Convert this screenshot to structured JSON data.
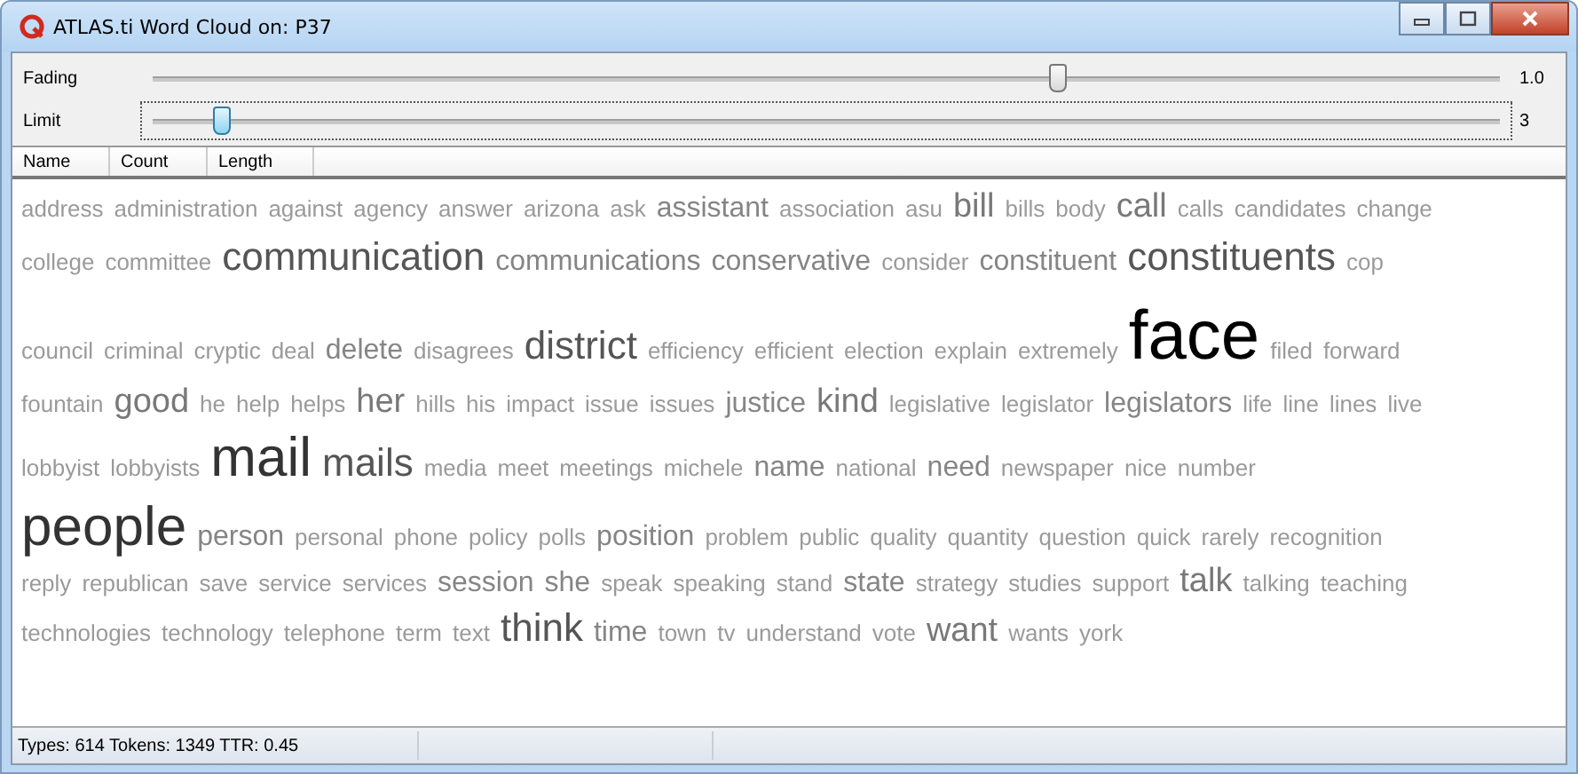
{
  "window": {
    "title": "ATLAS.ti Word Cloud on: P37"
  },
  "sliders": [
    {
      "label": "Fading",
      "level": 0.67,
      "reading": "1.0",
      "focused": false
    },
    {
      "label": "Limit",
      "level": 0.05,
      "reading": "3",
      "focused": true
    }
  ],
  "columns": [
    "Name",
    "Count",
    "Length"
  ],
  "cloud_lines": [
    [
      {
        "word": "address",
        "kind": "s"
      },
      {
        "word": "administration",
        "kind": "s"
      },
      {
        "word": "against",
        "kind": "s"
      },
      {
        "word": "agency",
        "kind": "s"
      },
      {
        "word": "answer",
        "kind": "s"
      },
      {
        "word": "arizona",
        "kind": "s"
      },
      {
        "word": "ask",
        "kind": "s"
      },
      {
        "word": "assistant",
        "kind": "m"
      },
      {
        "word": "association",
        "kind": "s"
      },
      {
        "word": "asu",
        "kind": "s"
      },
      {
        "word": "bill",
        "kind": "l"
      },
      {
        "word": "bills",
        "kind": "s"
      },
      {
        "word": "body",
        "kind": "s"
      },
      {
        "word": "call",
        "kind": "l"
      },
      {
        "word": "calls",
        "kind": "s"
      },
      {
        "word": "candidates",
        "kind": "s"
      },
      {
        "word": "change",
        "kind": "s"
      }
    ],
    [
      {
        "word": "college",
        "kind": "s"
      },
      {
        "word": "committee",
        "kind": "s"
      },
      {
        "word": "communication",
        "kind": "xl"
      },
      {
        "word": "communications",
        "kind": "m"
      },
      {
        "word": "conservative",
        "kind": "m"
      },
      {
        "word": "consider",
        "kind": "s"
      },
      {
        "word": "constituent",
        "kind": "m"
      },
      {
        "word": "constituents",
        "kind": "xl"
      },
      {
        "word": "cop",
        "kind": "s"
      }
    ],
    [
      {
        "word": "council",
        "kind": "s"
      },
      {
        "word": "criminal",
        "kind": "s"
      },
      {
        "word": "cryptic",
        "kind": "s"
      },
      {
        "word": "deal",
        "kind": "s"
      },
      {
        "word": "delete",
        "kind": "m"
      },
      {
        "word": "disagrees",
        "kind": "s"
      },
      {
        "word": "district",
        "kind": "xl"
      },
      {
        "word": "efficiency",
        "kind": "s"
      },
      {
        "word": "efficient",
        "kind": "s"
      },
      {
        "word": "election",
        "kind": "s"
      },
      {
        "word": "explain",
        "kind": "s"
      },
      {
        "word": "extremely",
        "kind": "s"
      },
      {
        "word": "face",
        "kind": "max"
      },
      {
        "word": "filed",
        "kind": "s"
      },
      {
        "word": "forward",
        "kind": "s"
      }
    ],
    [
      {
        "word": "fountain",
        "kind": "s"
      },
      {
        "word": "good",
        "kind": "l"
      },
      {
        "word": "he",
        "kind": "s"
      },
      {
        "word": "help",
        "kind": "s"
      },
      {
        "word": "helps",
        "kind": "s"
      },
      {
        "word": "her",
        "kind": "l"
      },
      {
        "word": "hills",
        "kind": "s"
      },
      {
        "word": "his",
        "kind": "s"
      },
      {
        "word": "impact",
        "kind": "s"
      },
      {
        "word": "issue",
        "kind": "s"
      },
      {
        "word": "issues",
        "kind": "s"
      },
      {
        "word": "justice",
        "kind": "m"
      },
      {
        "word": "kind",
        "kind": "l"
      },
      {
        "word": "legislative",
        "kind": "s"
      },
      {
        "word": "legislator",
        "kind": "s"
      },
      {
        "word": "legislators",
        "kind": "m"
      },
      {
        "word": "life",
        "kind": "s"
      },
      {
        "word": "line",
        "kind": "s"
      },
      {
        "word": "lines",
        "kind": "s"
      },
      {
        "word": "live",
        "kind": "s"
      }
    ],
    [
      {
        "word": "lobbyist",
        "kind": "s"
      },
      {
        "word": "lobbyists",
        "kind": "s"
      },
      {
        "word": "mail",
        "kind": "xxl"
      },
      {
        "word": "mails",
        "kind": "xl"
      },
      {
        "word": "media",
        "kind": "s"
      },
      {
        "word": "meet",
        "kind": "s"
      },
      {
        "word": "meetings",
        "kind": "s"
      },
      {
        "word": "michele",
        "kind": "s"
      },
      {
        "word": "name",
        "kind": "m"
      },
      {
        "word": "national",
        "kind": "s"
      },
      {
        "word": "need",
        "kind": "m"
      },
      {
        "word": "newspaper",
        "kind": "s"
      },
      {
        "word": "nice",
        "kind": "s"
      },
      {
        "word": "number",
        "kind": "s"
      }
    ],
    [
      {
        "word": "people",
        "kind": "xxl"
      },
      {
        "word": "person",
        "kind": "m"
      },
      {
        "word": "personal",
        "kind": "s"
      },
      {
        "word": "phone",
        "kind": "s"
      },
      {
        "word": "policy",
        "kind": "s"
      },
      {
        "word": "polls",
        "kind": "s"
      },
      {
        "word": "position",
        "kind": "m"
      },
      {
        "word": "problem",
        "kind": "s"
      },
      {
        "word": "public",
        "kind": "s"
      },
      {
        "word": "quality",
        "kind": "s"
      },
      {
        "word": "quantity",
        "kind": "s"
      },
      {
        "word": "question",
        "kind": "s"
      },
      {
        "word": "quick",
        "kind": "s"
      },
      {
        "word": "rarely",
        "kind": "s"
      },
      {
        "word": "recognition",
        "kind": "s"
      }
    ],
    [
      {
        "word": "reply",
        "kind": "s"
      },
      {
        "word": "republican",
        "kind": "s"
      },
      {
        "word": "save",
        "kind": "s"
      },
      {
        "word": "service",
        "kind": "s"
      },
      {
        "word": "services",
        "kind": "s"
      },
      {
        "word": "session",
        "kind": "m"
      },
      {
        "word": "she",
        "kind": "m"
      },
      {
        "word": "speak",
        "kind": "s"
      },
      {
        "word": "speaking",
        "kind": "s"
      },
      {
        "word": "stand",
        "kind": "s"
      },
      {
        "word": "state",
        "kind": "m"
      },
      {
        "word": "strategy",
        "kind": "s"
      },
      {
        "word": "studies",
        "kind": "s"
      },
      {
        "word": "support",
        "kind": "s"
      },
      {
        "word": "talk",
        "kind": "l"
      },
      {
        "word": "talking",
        "kind": "s"
      },
      {
        "word": "teaching",
        "kind": "s"
      }
    ],
    [
      {
        "word": "technologies",
        "kind": "s"
      },
      {
        "word": "technology",
        "kind": "s"
      },
      {
        "word": "telephone",
        "kind": "s"
      },
      {
        "word": "term",
        "kind": "s"
      },
      {
        "word": "text",
        "kind": "s"
      },
      {
        "word": "think",
        "kind": "xl"
      },
      {
        "word": "time",
        "kind": "m"
      },
      {
        "word": "town",
        "kind": "s"
      },
      {
        "word": "tv",
        "kind": "s"
      },
      {
        "word": "understand",
        "kind": "s"
      },
      {
        "word": "vote",
        "kind": "s"
      },
      {
        "word": "want",
        "kind": "l"
      },
      {
        "word": "wants",
        "kind": "s"
      },
      {
        "word": "york",
        "kind": "s"
      }
    ]
  ],
  "status_bar": "Types: 614 Tokens: 1349 TTR: 0.45"
}
